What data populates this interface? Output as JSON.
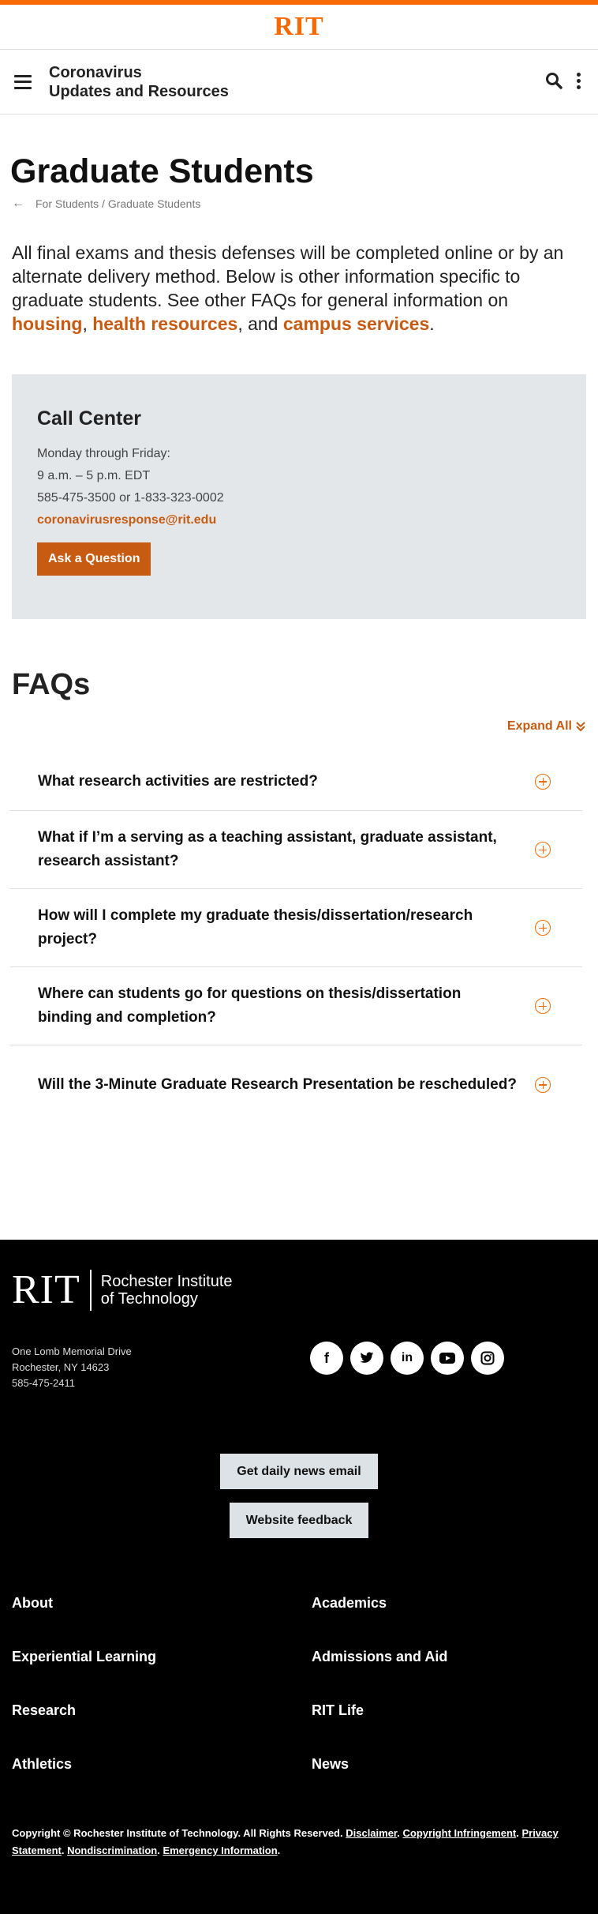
{
  "brand": {
    "logo": "RIT",
    "accent": "#f76902",
    "link_color": "#c75b12"
  },
  "site": {
    "title_line1": "Coronavirus",
    "title_line2": "Updates and Resources"
  },
  "page": {
    "title": "Graduate Students",
    "breadcrumb": "For Students / Graduate Students",
    "intro_text": "All final exams and thesis defenses will be completed online or by an alternate delivery method. Below is other information specific to graduate students. See other FAQs for general information on",
    "link_housing": "housing",
    "sep1": ",",
    "link_health": "health resources",
    "sep2": ", and",
    "link_campus": "campus services",
    "end": "."
  },
  "call_center": {
    "heading": "Call Center",
    "days": "Monday through Friday:",
    "hours": "9 a.m. – 5 p.m. EDT",
    "phone": "585-475-3500 or 1-833-323-0002",
    "email": "coronavirusresponse@rit.edu",
    "button": "Ask a Question"
  },
  "faqs": {
    "heading": "FAQs",
    "expand_all": "Expand All",
    "items": [
      "What research activities are restricted?",
      "What if I’m a serving as a teaching assistant, graduate assistant, research assistant?",
      "How will I complete my graduate thesis/dissertation/research project?",
      "Where can students go for questions on thesis/dissertation binding and completion?",
      "Will the 3-Minute Graduate Research Presentation be rescheduled?"
    ]
  },
  "footer": {
    "logo": "RIT",
    "name_line1": "Rochester Institute",
    "name_line2": "of Technology",
    "address_line1": "One Lomb Memorial Drive",
    "address_line2": "Rochester, NY 14623",
    "phone": "585-475-2411",
    "social_icons": [
      "facebook-icon",
      "twitter-icon",
      "linkedin-icon",
      "youtube-icon",
      "instagram-icon"
    ],
    "btn_news": "Get daily news email",
    "btn_feedback": "Website feedback",
    "nav": {
      "about": "About",
      "academics": "Academics",
      "experiential": "Experiential Learning",
      "admissions": "Admissions and Aid",
      "research": "Research",
      "rit_life": "RIT Life",
      "athletics": "Athletics",
      "news": "News"
    },
    "copyright": "Copyright © Rochester Institute of Technology. All Rights Reserved.",
    "disclaimer": "Disclaimer",
    "copyright_infringement": "Copyright Infringement",
    "privacy": "Privacy Statement",
    "nondiscrimination": "Nondiscrimination",
    "emergency": "Emergency Information"
  }
}
